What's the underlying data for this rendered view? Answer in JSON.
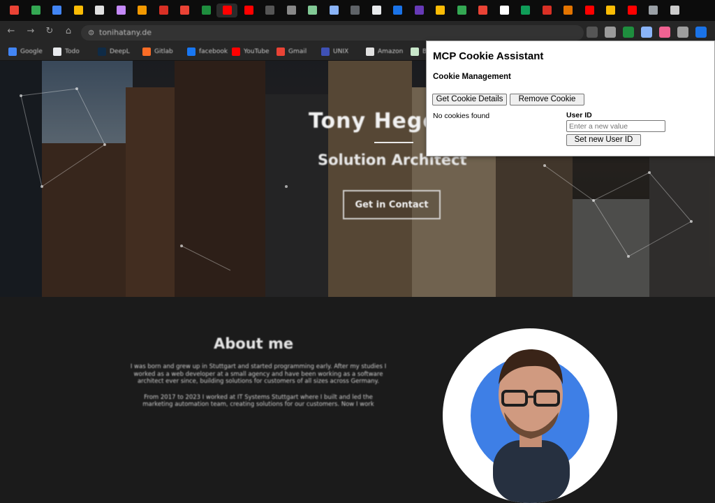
{
  "browser": {
    "tabs": [
      {
        "favicon_color": "#ea4335"
      },
      {
        "favicon_color": "#34a853"
      },
      {
        "favicon_color": "#4285f4"
      },
      {
        "favicon_color": "#fbbc05"
      },
      {
        "favicon_color": "#e0e0e0"
      },
      {
        "favicon_color": "#c58af9"
      },
      {
        "favicon_color": "#f29900"
      },
      {
        "favicon_color": "#d93025"
      },
      {
        "favicon_color": "#ea4335"
      },
      {
        "favicon_color": "#1e8e3e"
      },
      {
        "favicon_color": "#ff0000"
      },
      {
        "favicon_color": "#ff0000"
      },
      {
        "favicon_color": "#555555"
      },
      {
        "favicon_color": "#888888"
      },
      {
        "favicon_color": "#81c995"
      },
      {
        "favicon_color": "#8ab4f8"
      },
      {
        "favicon_color": "#5f6368"
      },
      {
        "favicon_color": "#e8eaed"
      },
      {
        "favicon_color": "#1a73e8"
      },
      {
        "favicon_color": "#673ab7"
      },
      {
        "favicon_color": "#fbbc05"
      },
      {
        "favicon_color": "#34a853"
      },
      {
        "favicon_color": "#ea4335"
      },
      {
        "favicon_color": "#ffffff"
      },
      {
        "favicon_color": "#0f9d58"
      },
      {
        "favicon_color": "#d93025"
      },
      {
        "favicon_color": "#e37400"
      },
      {
        "favicon_color": "#ff0000"
      },
      {
        "favicon_color": "#fbbc05"
      },
      {
        "favicon_color": "#ff0000"
      },
      {
        "favicon_color": "#9aa0a6"
      },
      {
        "favicon_color": "#cccccc"
      }
    ],
    "address_bar": {
      "url": "tonihatany.de"
    },
    "bookmarks": [
      {
        "label": "Google",
        "icon_color": "#4285f4"
      },
      {
        "label": "Todo",
        "icon_color": "#e8eaed"
      },
      {
        "label": "DeepL",
        "icon_color": "#0f2b46"
      },
      {
        "label": "Gitlab",
        "icon_color": "#fc6d26"
      },
      {
        "label": "facebook",
        "icon_color": "#1877f2"
      },
      {
        "label": "YouTube",
        "icon_color": "#ff0000"
      },
      {
        "label": "Gmail",
        "icon_color": "#ea4335"
      },
      {
        "label": "UNIX",
        "icon_color": "#3f51b5"
      },
      {
        "label": "Amazon",
        "icon_color": "#e0e0e0"
      },
      {
        "label": "B",
        "icon_color": "#c8e6c9"
      }
    ],
    "extensions": [
      {
        "name": "puzzle-icon",
        "color": "#555555"
      },
      {
        "name": "star-icon",
        "color": "#9a9a9a"
      },
      {
        "name": "ext-green-icon",
        "color": "#1e8e3e"
      },
      {
        "name": "ext-cookie-icon",
        "color": "#8ab4f8"
      },
      {
        "name": "ext-pink-icon",
        "color": "#f06292"
      },
      {
        "name": "ext-gray-icon",
        "color": "#9e9e9e"
      },
      {
        "name": "profile-icon",
        "color": "#1a73e8"
      }
    ]
  },
  "page": {
    "hero_name": "Tony Hege",
    "hero_role": "Solution Architect",
    "contact_button": "Get in Contact",
    "about_title": "About me",
    "about_paragraphs": [
      "I was born and grew up in Stuttgart and started programming early. After my studies I worked as a web developer at a small agency and have been working as a software architect ever since, building solutions for customers of all sizes across Germany.",
      "From 2017 to 2023 I worked at IT Systems Stuttgart where I built and led the marketing automation team, creating solutions for our customers. Now I work"
    ]
  },
  "popup": {
    "title": "MCP Cookie Assistant",
    "subtitle": "Cookie Management",
    "get_details_button": "Get Cookie Details",
    "remove_button": "Remove Cookie",
    "status_text": "No cookies found",
    "user_id_label": "User ID",
    "user_id_placeholder": "Enter a new value",
    "user_id_value": "",
    "set_user_button": "Set new User ID"
  },
  "colors": {
    "popup_bg": "#ffffff",
    "avatar_ring": "#3e7fe6",
    "page_bg": "#1b1b1b"
  }
}
